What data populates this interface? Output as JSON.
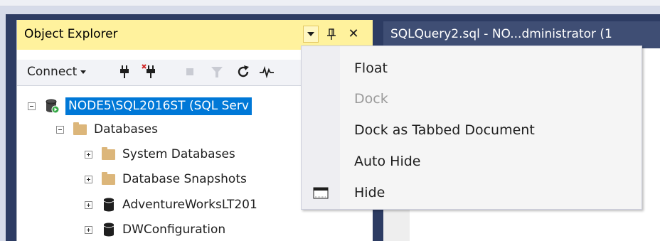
{
  "object_explorer": {
    "title": "Object Explorer",
    "title_bar_buttons": {
      "dropdown": "chevron-down-icon",
      "pin": "1",
      "close": "✕"
    },
    "toolbar": {
      "connect_label": "Connect"
    },
    "tree": [
      {
        "label": "NODE5\\SQL2016ST (SQL Serv",
        "icon": "server-icon",
        "expander": "minus",
        "selected": true
      },
      {
        "label": "Databases",
        "icon": "folder-icon",
        "expander": "minus"
      },
      {
        "label": "System Databases",
        "icon": "folder-icon",
        "expander": "plus"
      },
      {
        "label": "Database Snapshots",
        "icon": "folder-icon",
        "expander": "plus"
      },
      {
        "label": "AdventureWorksLT201",
        "icon": "database-icon",
        "expander": "plus"
      },
      {
        "label": "DWConfiguration",
        "icon": "database-icon",
        "expander": "plus"
      }
    ]
  },
  "document_tab": {
    "title": "SQLQuery2.sql - NO...dministrator (1"
  },
  "context_menu": {
    "items": [
      {
        "label": "Float",
        "enabled": true
      },
      {
        "label": "Dock",
        "enabled": false
      },
      {
        "label": "Dock as Tabbed Document",
        "enabled": true
      },
      {
        "label": "Auto Hide",
        "enabled": true
      },
      {
        "label": "Hide",
        "enabled": true,
        "icon": "window-icon"
      }
    ]
  },
  "colors": {
    "title_bar_active": "#fff29d",
    "ide_background": "#2d3c63",
    "selection": "#0078d7",
    "connect_green": "#35a845"
  }
}
